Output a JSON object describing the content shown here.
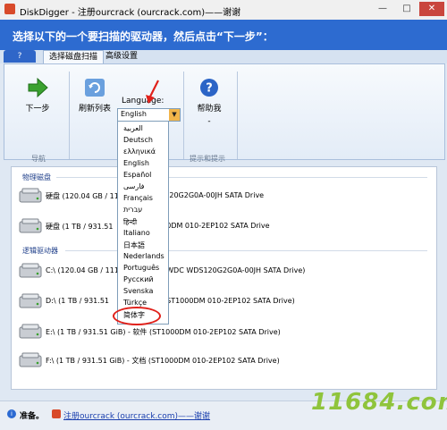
{
  "window": {
    "title": "DiskDigger - 注册ourcrack (ourcrack.com)——谢谢"
  },
  "banner": {
    "text": "选择以下的一个要扫描的驱动器，然后点击“下一步”："
  },
  "tabs": {
    "help": "?",
    "scan": "选择磁盘扫描",
    "advanced": "高级设置"
  },
  "ribbon": {
    "next_label": "下一步",
    "refresh_label": "刷新列表",
    "help_label": "帮助我",
    "help_sub": "-",
    "language_label": "Language:",
    "language_value": "English",
    "group_nav": "导航",
    "group_tips": "提示和提示"
  },
  "languages": [
    "العربية",
    "Deutsch",
    "ελληνικά",
    "English",
    "Español",
    "فارسی",
    "Français",
    "עברית",
    "हिन्दी",
    "Italiano",
    "日本語",
    "Nederlands",
    "Português",
    "Русский",
    "Svenska",
    "Türkçe",
    "简体字"
  ],
  "panel": {
    "physical_header": "物理磁盘",
    "logical_header": "逻辑驱动器",
    "physical": [
      {
        "left": "硬盘 (120.04 GB / 11",
        "right": "C WDS120G2G0A-00JH SATA Drive"
      },
      {
        "left": "硬盘 (1 TB / 931.51",
        "right": "ST1000DM 010-2EP102 SATA Drive"
      }
    ],
    "logical": [
      {
        "left": "C:\\ (120.04 GB / 111.",
        "right": "(WDC WDS120G2G0A-00JH SATA Drive)"
      },
      {
        "left": "D:\\ (1 TB / 931.51",
        "right": "(ST1000DM 010-2EP102 SATA Drive)"
      },
      {
        "left": "E:\\ (1 TB / 931.51 GiB) - 软件 (ST1000DM 010-2EP102 SATA Drive)",
        "right": ""
      },
      {
        "left": "F:\\ (1 TB / 931.51 GiB) - 文档 (ST1000DM 010-2EP102 SATA Drive)",
        "right": ""
      }
    ]
  },
  "status": {
    "ready": "准备。",
    "link": "注册ourcrack (ourcrack.com)——谢谢"
  },
  "watermark": "11684.com",
  "colors": {
    "banner": "#2d6bd0",
    "accent_red": "#e0201a",
    "watermark": "#8fc43c"
  }
}
